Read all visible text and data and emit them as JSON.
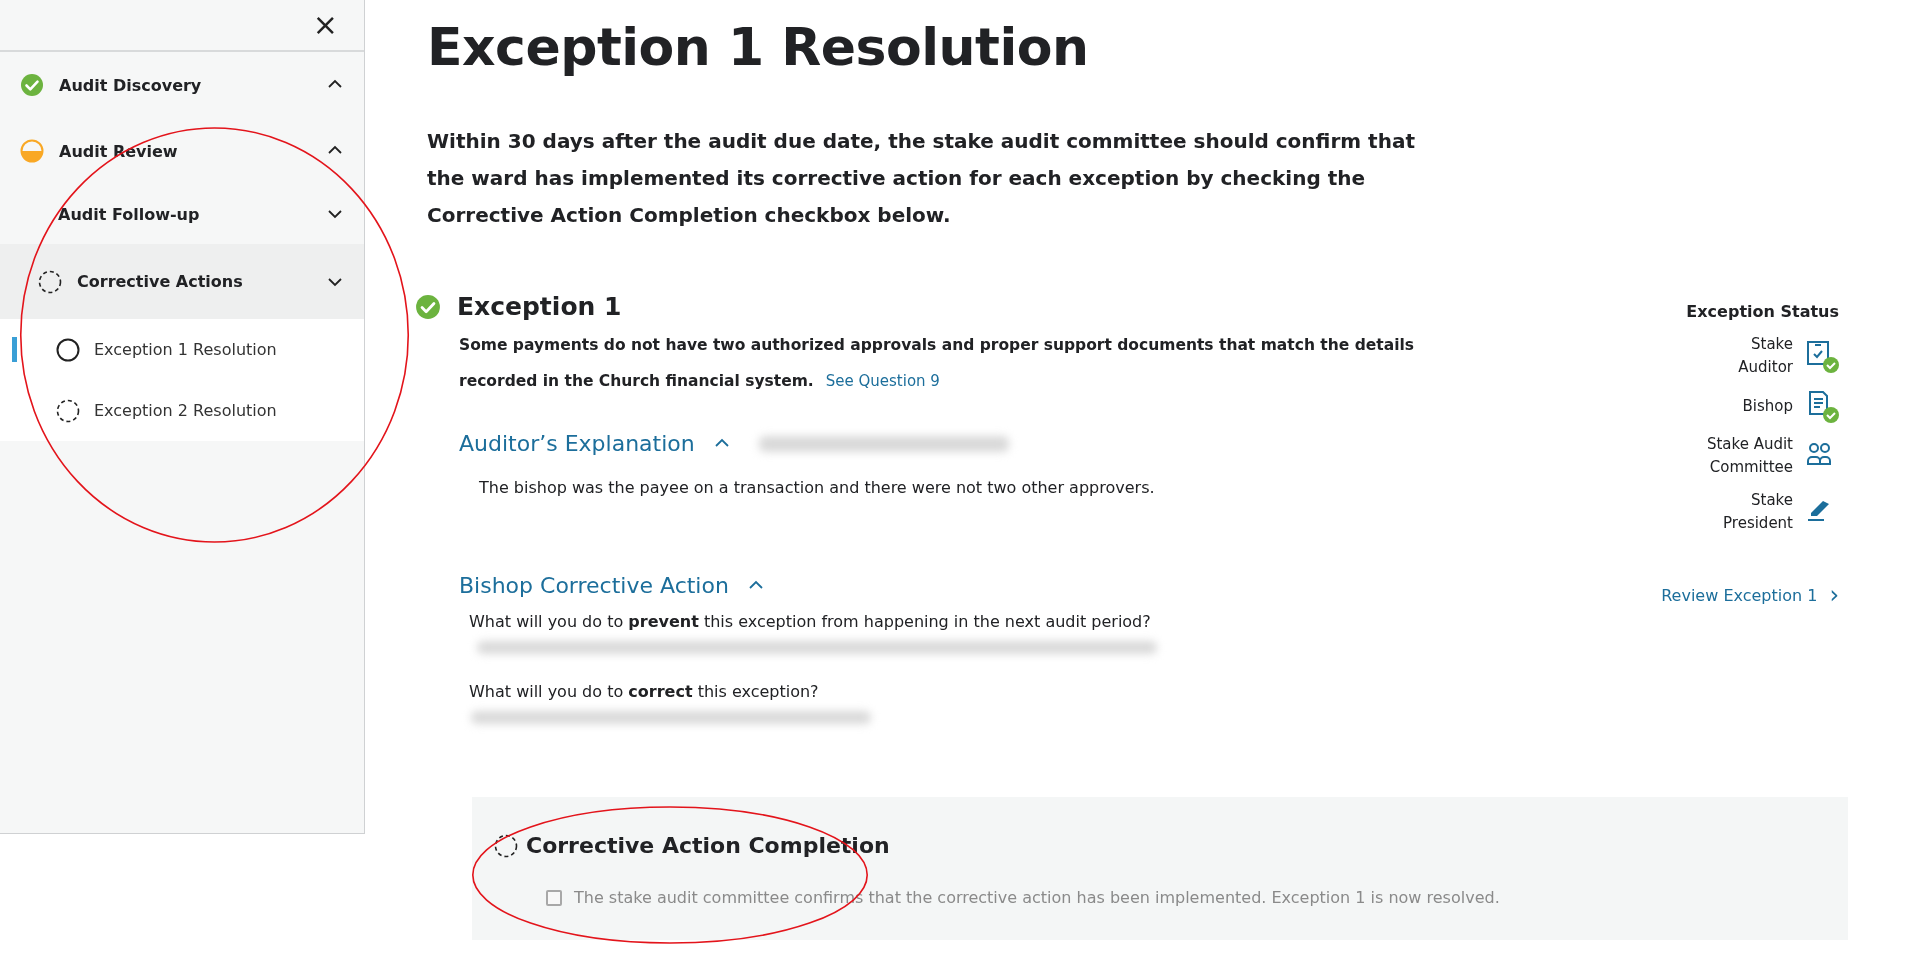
{
  "sidebar": {
    "close_label": "×",
    "sections": [
      {
        "label": "Audit Discovery",
        "kind": "done",
        "expanded": true,
        "selected": false
      },
      {
        "label": "Audit Review",
        "kind": "half",
        "expanded": true,
        "selected": false,
        "children": [
          {
            "label": "Audit Follow-up",
            "kind": "plain",
            "expanded": false,
            "selected": false
          },
          {
            "label": "Corrective Actions",
            "kind": "dashed",
            "expanded": false,
            "selected": true,
            "children": [
              {
                "label": "Exception 1 Resolution",
                "kind": "ring",
                "selected": true
              },
              {
                "label": "Exception 2 Resolution",
                "kind": "dashed",
                "selected": false
              }
            ]
          }
        ]
      }
    ]
  },
  "page": {
    "title": "Exception 1 Resolution",
    "intro": "Within 30 days after the audit due date, the stake audit committee should confirm that the ward has implemented its corrective action for each exception by checking the Corrective Action Completion checkbox below."
  },
  "exception": {
    "title": "Exception 1",
    "kind": "done",
    "description": "Some payments do not have two authorized approvals and proper support documents that match the details recorded in the Church financial system.",
    "link": "See Question 9",
    "explanation": {
      "title": "Auditor’s Explanation",
      "expanded": true,
      "author_redacted": true,
      "text": "The bishop was the payee on a transaction and there were not two other approvers."
    },
    "corrective_action": {
      "title": "Bishop Corrective Action",
      "expanded": true,
      "questions": [
        {
          "text": "What will you do to **prevent** this exception from happening in the next audit period?",
          "answer_redacted": true
        },
        {
          "text": "What will you do to **correct** this exception?",
          "answer_redacted": true
        }
      ]
    }
  },
  "status_panel": {
    "title": "Exception Status",
    "roles": [
      {
        "label": "Stake Auditor",
        "kind": "checklist",
        "done": true
      },
      {
        "label": "Bishop",
        "kind": "document",
        "done": true
      },
      {
        "label": "Stake Audit Committee",
        "kind": "people",
        "done": false
      },
      {
        "label": "Stake President",
        "kind": "sign",
        "done": false
      }
    ],
    "link": "Review Exception 1",
    "link_icon": "›"
  },
  "completion": {
    "title": "Corrective Action Completion",
    "kind": "dashed",
    "checkbox_label": "The stake audit committee confirms that the corrective action has been implemented. Exception 1 is now resolved.",
    "checked": false,
    "disabled": true
  },
  "annotations": {
    "sidebar_ellipse": true,
    "completion_ellipse": true
  }
}
